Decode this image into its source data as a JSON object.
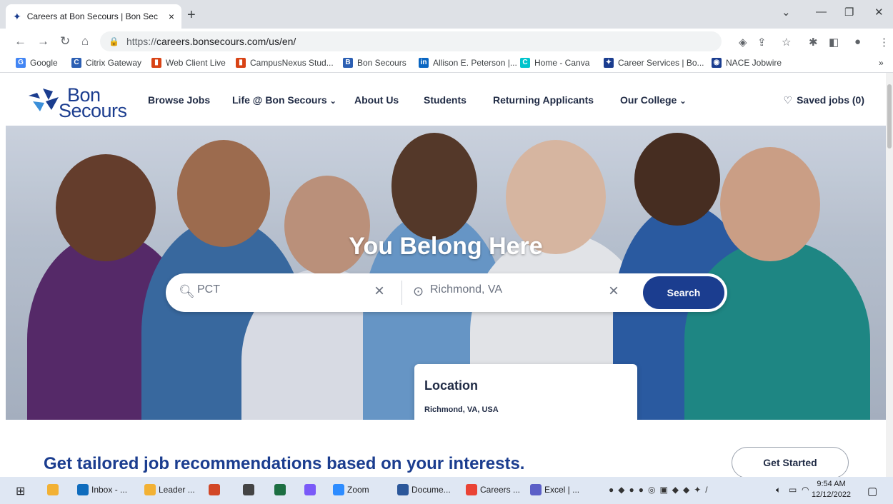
{
  "browser": {
    "tab_title": "Careers at Bon Secours | Bon Sec",
    "tab_close": "×",
    "new_tab": "+",
    "url_proto": "https://",
    "url_rest": "careers.bonsecours.com/us/en/",
    "bookmarks": [
      {
        "label": "Google",
        "icon": "google-icon",
        "color": "#4285f4",
        "glyph": "G"
      },
      {
        "label": "Citrix Gateway",
        "icon": "citrix-icon",
        "color": "#2c5fb3",
        "glyph": "C"
      },
      {
        "label": "Web Client Live",
        "icon": "bars-icon",
        "color": "#d84315",
        "glyph": "▮"
      },
      {
        "label": "CampusNexus Stud...",
        "icon": "bars-icon",
        "color": "#d84315",
        "glyph": "▮"
      },
      {
        "label": "Bon Secours",
        "icon": "citrix-icon",
        "color": "#2c5fb3",
        "glyph": "B"
      },
      {
        "label": "Allison E. Peterson |...",
        "icon": "linkedin-icon",
        "color": "#0a66c2",
        "glyph": "in"
      },
      {
        "label": "Home - Canva",
        "icon": "canva-icon",
        "color": "#00c4cc",
        "glyph": "C"
      },
      {
        "label": "Career Services | Bo...",
        "icon": "bonsecours-icon",
        "color": "#1b3d8f",
        "glyph": "✦"
      },
      {
        "label": "NACE Jobwire",
        "icon": "nace-icon",
        "color": "#1b3d8f",
        "glyph": "◉"
      }
    ],
    "bookmarks_more": "»"
  },
  "site": {
    "logo_line1": "Bon",
    "logo_line2": "Secours",
    "menu": [
      {
        "label": "Browse Jobs",
        "dropdown": false
      },
      {
        "label": "Life @ Bon Secours",
        "dropdown": true
      },
      {
        "label": "About Us",
        "dropdown": false
      },
      {
        "label": "Students",
        "dropdown": false
      },
      {
        "label": "Returning Applicants",
        "dropdown": false
      },
      {
        "label": "Our College",
        "dropdown": true
      }
    ],
    "saved_jobs": "Saved jobs (0)"
  },
  "hero": {
    "title": "You Belong Here",
    "keyword_value": "PCT",
    "location_value": "Richmond, VA",
    "search_label": "Search"
  },
  "dropdown": {
    "heading": "Location",
    "item": "Richmond, VA, USA"
  },
  "promo": {
    "text": "Get tailored job recommendations based on your interests.",
    "button": "Get Started"
  },
  "taskbar": {
    "apps": [
      {
        "label": "",
        "icon": "file-explorer-icon",
        "color": "#f2b134"
      },
      {
        "label": "Inbox - ...",
        "icon": "outlook-icon",
        "color": "#0f6cbd"
      },
      {
        "label": "Leader ...",
        "icon": "mail-icon",
        "color": "#f2b134"
      },
      {
        "label": "",
        "icon": "powerpoint-icon",
        "color": "#d24726"
      },
      {
        "label": "",
        "icon": "app-icon",
        "color": "#444"
      },
      {
        "label": "",
        "icon": "excel-icon",
        "color": "#1d6f42"
      },
      {
        "label": "",
        "icon": "snip-icon",
        "color": "#7a5af8"
      },
      {
        "label": "Zoom",
        "icon": "zoom-icon",
        "color": "#2d8cff"
      },
      {
        "label": "Docume...",
        "icon": "word-icon",
        "color": "#2b579a"
      },
      {
        "label": "Careers ...",
        "icon": "chrome-icon",
        "color": "#ea4335"
      },
      {
        "label": "Excel | ...",
        "icon": "teams-icon",
        "color": "#5b5fc7"
      }
    ],
    "time": "9:54 AM",
    "date": "12/12/2022"
  }
}
